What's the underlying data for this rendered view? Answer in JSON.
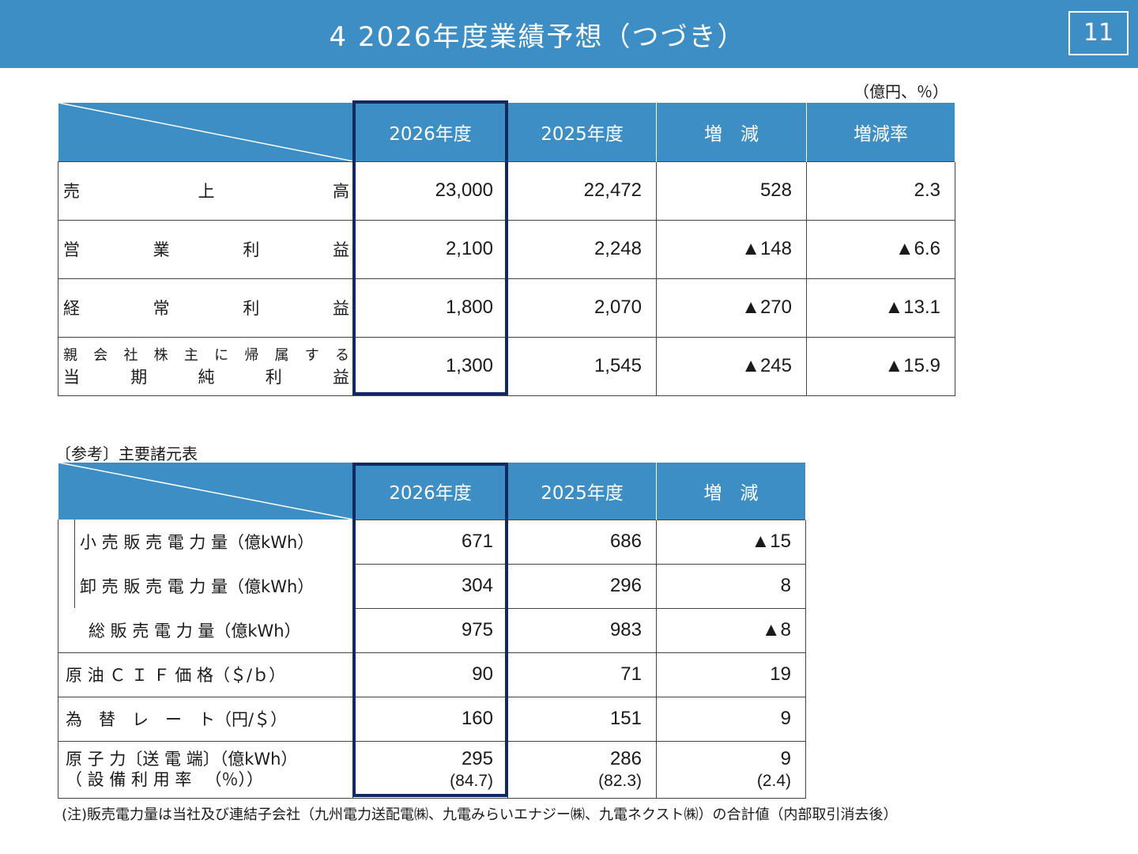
{
  "header": {
    "title": "4 2026年度業績予想（つづき）",
    "page_number": "11"
  },
  "unit_note": "（億円、％）",
  "table1": {
    "columns": [
      "2026年度",
      "2025年度",
      "増　減",
      "増減率"
    ],
    "rows": [
      {
        "label_chars": [
          "売",
          "上",
          "高"
        ],
        "values": [
          "23,000",
          "22,472",
          "528",
          "2.3"
        ]
      },
      {
        "label_chars": [
          "営",
          "業",
          "利",
          "益"
        ],
        "values": [
          "2,100",
          "2,248",
          "▲148",
          "▲6.6"
        ]
      },
      {
        "label_chars": [
          "経",
          "常",
          "利",
          "益"
        ],
        "values": [
          "1,800",
          "2,070",
          "▲270",
          "▲13.1"
        ]
      },
      {
        "label_line1": [
          "親",
          "会",
          "社",
          "株",
          "主",
          "に",
          "帰",
          "属",
          "す",
          "る"
        ],
        "label_line2": [
          "当",
          "期",
          "純",
          "利",
          "益"
        ],
        "values": [
          "1,300",
          "1,545",
          "▲245",
          "▲15.9"
        ]
      }
    ]
  },
  "reference_label": "〔参考〕主要諸元表",
  "table2": {
    "columns": [
      "2026年度",
      "2025年度",
      "増　減"
    ],
    "rows": [
      {
        "label": "小 売 販 売 電 力 量（億kWh）",
        "values": [
          "671",
          "686",
          "▲15"
        ]
      },
      {
        "label": "卸 売 販 売 電 力 量（億kWh）",
        "values": [
          "304",
          "296",
          "8"
        ]
      },
      {
        "label": "総 販 売 電 力 量（億kWh）",
        "values": [
          "975",
          "983",
          "▲8"
        ]
      },
      {
        "label": "原 油 Ｃ Ｉ Ｆ 価 格（＄/ｂ）",
        "values": [
          "90",
          "71",
          "19"
        ]
      },
      {
        "label": "為　替　レ　ー　ト（円/＄）",
        "values": [
          "160",
          "151",
          "9"
        ]
      },
      {
        "label": "原 子 力〔送 電 端〕（億kWh）",
        "label2": "（ 設 備 利 用 率 　（％））",
        "values": [
          "295",
          "286",
          "9"
        ],
        "values2": [
          "(84.7)",
          "(82.3)",
          "(2.4)"
        ]
      }
    ]
  },
  "footnote": "(注)販売電力量は当社及び連結子会社（九州電力送配電㈱、九電みらいエナジー㈱、九電ネクスト㈱）の合計値（内部取引消去後）",
  "colors": {
    "header_bg": "#3d8ec4",
    "highlight_border": "#0e2a5e"
  }
}
